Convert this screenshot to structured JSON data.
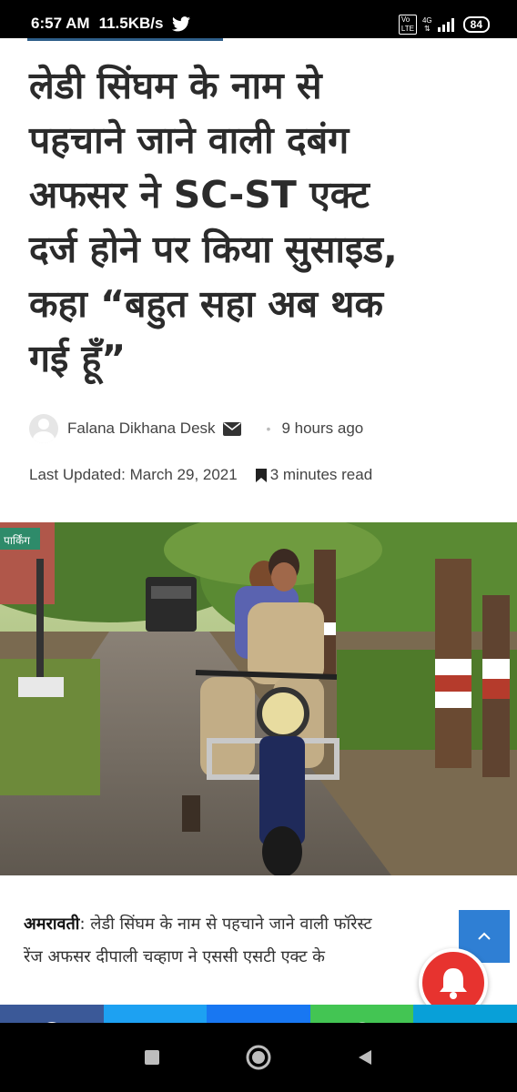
{
  "status_bar": {
    "time": "6:57 AM",
    "speed": "11.5KB/s",
    "network": "4G",
    "battery": "84"
  },
  "article": {
    "headline_lines": [
      "लेडी सिंघम के नाम से",
      "पहचाने जाने वाली दबंग",
      "अफसर ने SC-ST एक्ट",
      "दर्ज होने पर किया सुसाइड,",
      "कहा “बहुत सहा अब थक",
      "गई हूँ”"
    ],
    "author": "Falana Dikhana Desk",
    "time_ago": "9 hours ago",
    "last_updated": "Last Updated: March 29, 2021",
    "read_time": "3 minutes read",
    "photo_sign": "पार्किंग",
    "body_location": "अमरावती",
    "body_line1": ": लेडी सिंघम के नाम से पहचाने जाने वाली फॉरेस्ट",
    "body_line2": "रेंज अफसर दीपाली चव्हाण ने एससी एसटी एक्ट के"
  },
  "share_bar": [
    {
      "name": "facebook",
      "color": "#3b5998",
      "icon": "facebook-icon"
    },
    {
      "name": "twitter",
      "color": "#1da1f2",
      "icon": "twitter-icon"
    },
    {
      "name": "messenger",
      "color": "#1877f2",
      "icon": "messenger-icon"
    },
    {
      "name": "whatsapp",
      "color": "#43c553",
      "icon": "whatsapp-icon"
    },
    {
      "name": "telegram",
      "color": "#08a0d8",
      "icon": "telegram-icon"
    }
  ],
  "colors": {
    "accent": "#2f7fd4",
    "notify": "#e7332f"
  }
}
